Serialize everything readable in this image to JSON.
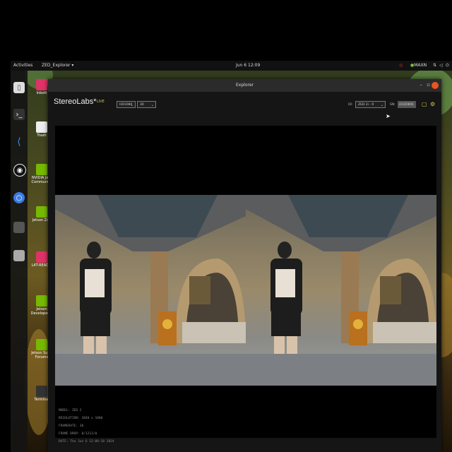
{
  "topbar": {
    "activities": "Activities",
    "app_menu": "ZED_Explorer ▾",
    "clock": "Jun 6 12:09",
    "power_mode": "MAXN"
  },
  "desktop_icons": [
    {
      "label": "Inbott"
    },
    {
      "label": "Trash"
    },
    {
      "label": "NVIDIA Jets Community"
    },
    {
      "label": "Jetson Zoo"
    },
    {
      "label": "L4T-READM"
    },
    {
      "label": "Jetson Developer Z"
    },
    {
      "label": "Jetson Supp Forums"
    },
    {
      "label": "Terminal"
    }
  ],
  "dock": {
    "items": [
      "files-icon",
      "terminal-icon",
      "vscode-icon",
      "obs-icon",
      "chromium-icon",
      "app-icon",
      "drive-icon"
    ]
  },
  "window": {
    "title": "Explorer",
    "brand": "StereoLabs*",
    "live_label": "LIVE",
    "resolution_select": "HD1080",
    "fps_select": "30",
    "id_label": "ID:",
    "camera_select": "ZED 2i - 0",
    "sn_label": "SN:",
    "sn_value": "44320806"
  },
  "camera_info": {
    "model": "MODEL: ZED 2",
    "resolution": "RESOLUTION: 3840 x 1080",
    "framerate": "FRAMERATE: 30",
    "frame_drop": "FRAME DROP: 0/1211/0",
    "date": "DATE: Thu Jun 6 12:09:18 2024"
  },
  "colors": {
    "accent": "#d7c84a",
    "close_button": "#e95420",
    "window_bg": "#151515"
  }
}
